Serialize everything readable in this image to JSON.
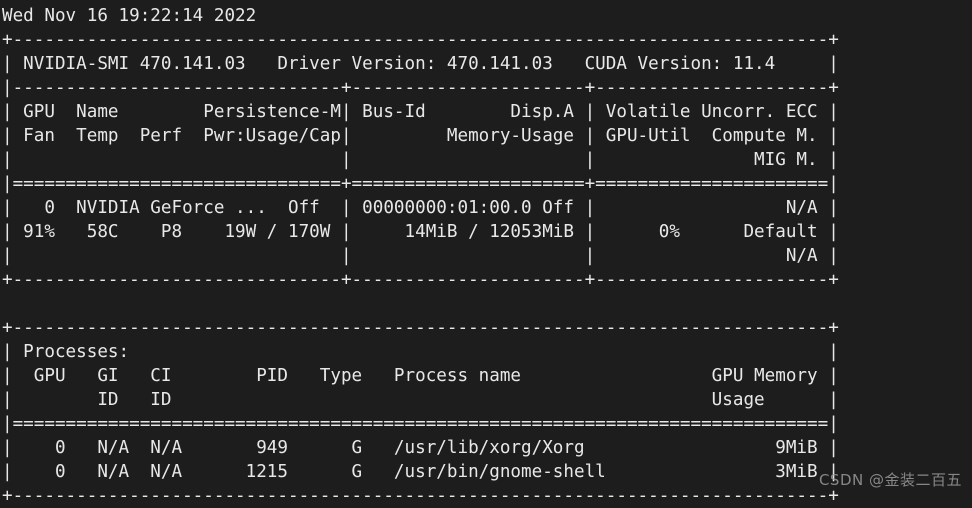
{
  "terminal": {
    "background_color": "#1d1d1d",
    "text_color": "#e8e8e8",
    "timestamp": "Wed Nov 16 19:22:14 2022",
    "lines": [
      "Wed Nov 16 19:22:14 2022",
      "+-----------------------------------------------------------------------------+",
      "| NVIDIA-SMI 470.141.03   Driver Version: 470.141.03   CUDA Version: 11.4     |",
      "|-------------------------------+----------------------+----------------------+",
      "| GPU  Name        Persistence-M| Bus-Id        Disp.A | Volatile Uncorr. ECC |",
      "| Fan  Temp  Perf  Pwr:Usage/Cap|         Memory-Usage | GPU-Util  Compute M. |",
      "|                               |                      |               MIG M. |",
      "|===============================+======================+======================|",
      "|   0  NVIDIA GeForce ...  Off  | 00000000:01:00.0 Off |                  N/A |",
      "| 91%   58C    P8    19W / 170W |     14MiB / 12053MiB |      0%      Default |",
      "|                               |                      |                  N/A |",
      "+-------------------------------+----------------------+----------------------+",
      "",
      "+-----------------------------------------------------------------------------+",
      "| Processes:                                                                  |",
      "|  GPU   GI   CI        PID   Type   Process name                  GPU Memory |",
      "|        ID   ID                                                   Usage      |",
      "|=============================================================================|",
      "|    0   N/A  N/A       949      G   /usr/lib/xorg/Xorg                  9MiB |",
      "|    0   N/A  N/A      1215      G   /usr/bin/gnome-shell                3MiB |",
      "+-----------------------------------------------------------------------------+"
    ],
    "smi": {
      "version": "470.141.03",
      "driver_version": "470.141.03",
      "cuda_version": "11.4"
    },
    "gpu_table": {
      "headers": [
        [
          "GPU",
          "Name",
          "Persistence-M",
          "Bus-Id",
          "Disp.A",
          "Volatile Uncorr. ECC"
        ],
        [
          "Fan",
          "Temp",
          "Perf",
          "Pwr:Usage/Cap",
          "Memory-Usage",
          "GPU-Util",
          "Compute M."
        ],
        [
          "MIG M."
        ]
      ],
      "rows": [
        {
          "gpu": "0",
          "name": "NVIDIA GeForce ...",
          "persistence_m": "Off",
          "bus_id": "00000000:01:00.0",
          "disp_a": "Off",
          "ecc": "N/A",
          "fan": "91%",
          "temp": "58C",
          "perf": "P8",
          "pwr_usage_cap": "19W / 170W",
          "memory_usage": "14MiB / 12053MiB",
          "gpu_util": "0%",
          "compute_m": "Default",
          "mig_m": "N/A"
        }
      ]
    },
    "processes_table": {
      "title": "Processes:",
      "headers": [
        "GPU",
        "GI ID",
        "CI ID",
        "PID",
        "Type",
        "Process name",
        "GPU Memory Usage"
      ],
      "rows": [
        {
          "gpu": "0",
          "gi_id": "N/A",
          "ci_id": "N/A",
          "pid": "949",
          "type": "G",
          "process_name": "/usr/lib/xorg/Xorg",
          "gpu_memory_usage": "9MiB"
        },
        {
          "gpu": "0",
          "gi_id": "N/A",
          "ci_id": "N/A",
          "pid": "1215",
          "type": "G",
          "process_name": "/usr/bin/gnome-shell",
          "gpu_memory_usage": "3MiB"
        }
      ]
    }
  },
  "watermark": {
    "text": "CSDN @金装二百五",
    "color": "#9a9a9a"
  }
}
